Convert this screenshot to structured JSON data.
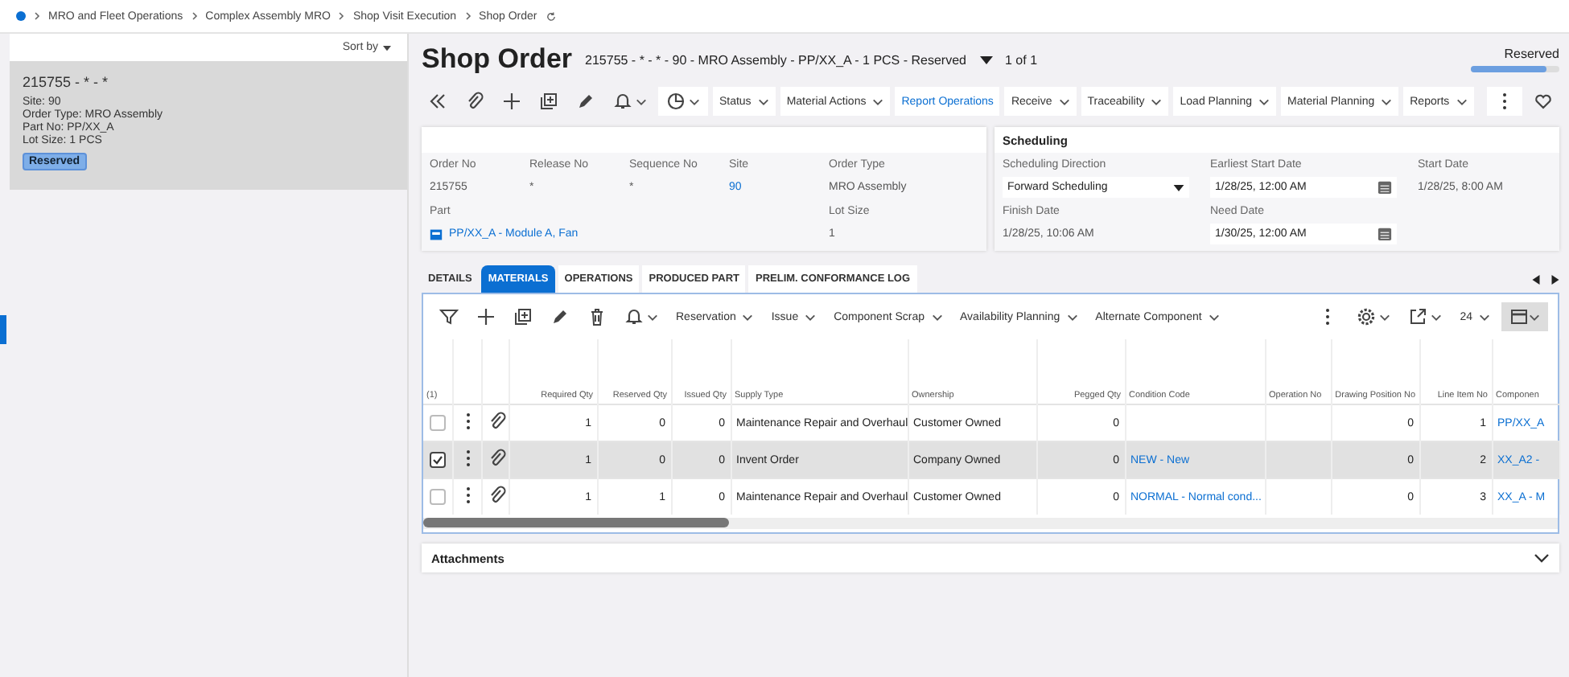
{
  "breadcrumb": [
    "MRO and Fleet Operations",
    "Complex Assembly MRO",
    "Shop Visit Execution",
    "Shop Order"
  ],
  "list_panel": {
    "sort_label": "Sort by",
    "cards": [
      {
        "title": "215755 - * - *",
        "lines": [
          "Site:  90",
          "Order Type:  MRO Assembly",
          "Part No:  PP/XX_A",
          "Lot Size:  1 PCS"
        ],
        "status": "Reserved",
        "selected": true
      }
    ]
  },
  "header": {
    "title": "Shop Order",
    "subtitle": "215755 - * - * - 90 - MRO Assembly - PP/XX_A - 1 PCS - Reserved",
    "counter": "1 of 1",
    "status": "Reserved",
    "level": 0.85
  },
  "toolbar": [
    {
      "label": "Status",
      "kind": "menu"
    },
    {
      "label": "Material Actions",
      "kind": "menu"
    },
    {
      "label": "Report Operations",
      "kind": "link"
    },
    {
      "label": "Receive",
      "kind": "menu"
    },
    {
      "label": "Traceability",
      "kind": "menu"
    },
    {
      "label": "Load Planning",
      "kind": "menu"
    },
    {
      "label": "Material Planning",
      "kind": "menu"
    },
    {
      "label": "Reports",
      "kind": "menu"
    }
  ],
  "order_card": {
    "fields": [
      {
        "label": "Order No",
        "value": "215755",
        "kind": "text"
      },
      {
        "label": "Release No",
        "value": "*",
        "kind": "text"
      },
      {
        "label": "Sequence No",
        "value": "*",
        "kind": "text"
      },
      {
        "label": "Site",
        "value": "90",
        "kind": "link"
      },
      {
        "label": "Order Type",
        "value": "MRO Assembly",
        "kind": "text"
      },
      {
        "label": "Part",
        "value": "PP/XX_A - Module A, Fan",
        "kind": "part"
      },
      {
        "label": "Lot Size",
        "value": "1",
        "kind": "text"
      }
    ]
  },
  "scheduling": {
    "title": "Scheduling",
    "fields": [
      {
        "label": "Scheduling Direction",
        "value": "Forward Scheduling",
        "kind": "select"
      },
      {
        "label": "Earliest Start Date",
        "value": "1/28/25, 12:00 AM",
        "kind": "date"
      },
      {
        "label": "Start Date",
        "value": "1/28/25, 8:00 AM",
        "kind": "text"
      },
      {
        "label": "Finish Date",
        "value": "1/28/25, 10:06 AM",
        "kind": "text"
      },
      {
        "label": "Need Date",
        "value": "1/30/25, 12:00 AM",
        "kind": "date"
      }
    ]
  },
  "tabs": [
    {
      "label": "DETAILS",
      "selected": false
    },
    {
      "label": "MATERIALS",
      "selected": true
    },
    {
      "label": "OPERATIONS",
      "selected": false
    },
    {
      "label": "PRODUCED PART",
      "selected": false
    },
    {
      "label": "PRELIM. CONFORMANCE LOG",
      "selected": false
    }
  ],
  "materials": {
    "menus": [
      "Reservation",
      "Issue",
      "Component Scrap",
      "Availability Planning",
      "Alternate Component"
    ],
    "page_size": "24",
    "selection_count": "(1)",
    "columns": [
      "Required Qty",
      "Reserved Qty",
      "Issued Qty",
      "Supply Type",
      "Ownership",
      "Pegged Qty",
      "Condition Code",
      "Operation No",
      "Drawing Position No",
      "Line Item No",
      "Componen"
    ],
    "rows": [
      {
        "selected": false,
        "cells": [
          "1",
          "0",
          "0",
          "Maintenance Repair and Overhaul",
          "Customer Owned",
          "0",
          "",
          "",
          "0",
          "1",
          "PP/XX_A"
        ]
      },
      {
        "selected": true,
        "cells": [
          "1",
          "0",
          "0",
          "Invent Order",
          "Company Owned",
          "0",
          "NEW - New",
          "",
          "0",
          "2",
          "XX_A2 -"
        ]
      },
      {
        "selected": false,
        "cells": [
          "1",
          "1",
          "0",
          "Maintenance Repair and Overhaul",
          "Customer Owned",
          "0",
          "NORMAL - Normal cond...",
          "",
          "0",
          "3",
          "XX_A - M"
        ]
      }
    ]
  },
  "attachments": {
    "title": "Attachments",
    "expanded": false
  }
}
